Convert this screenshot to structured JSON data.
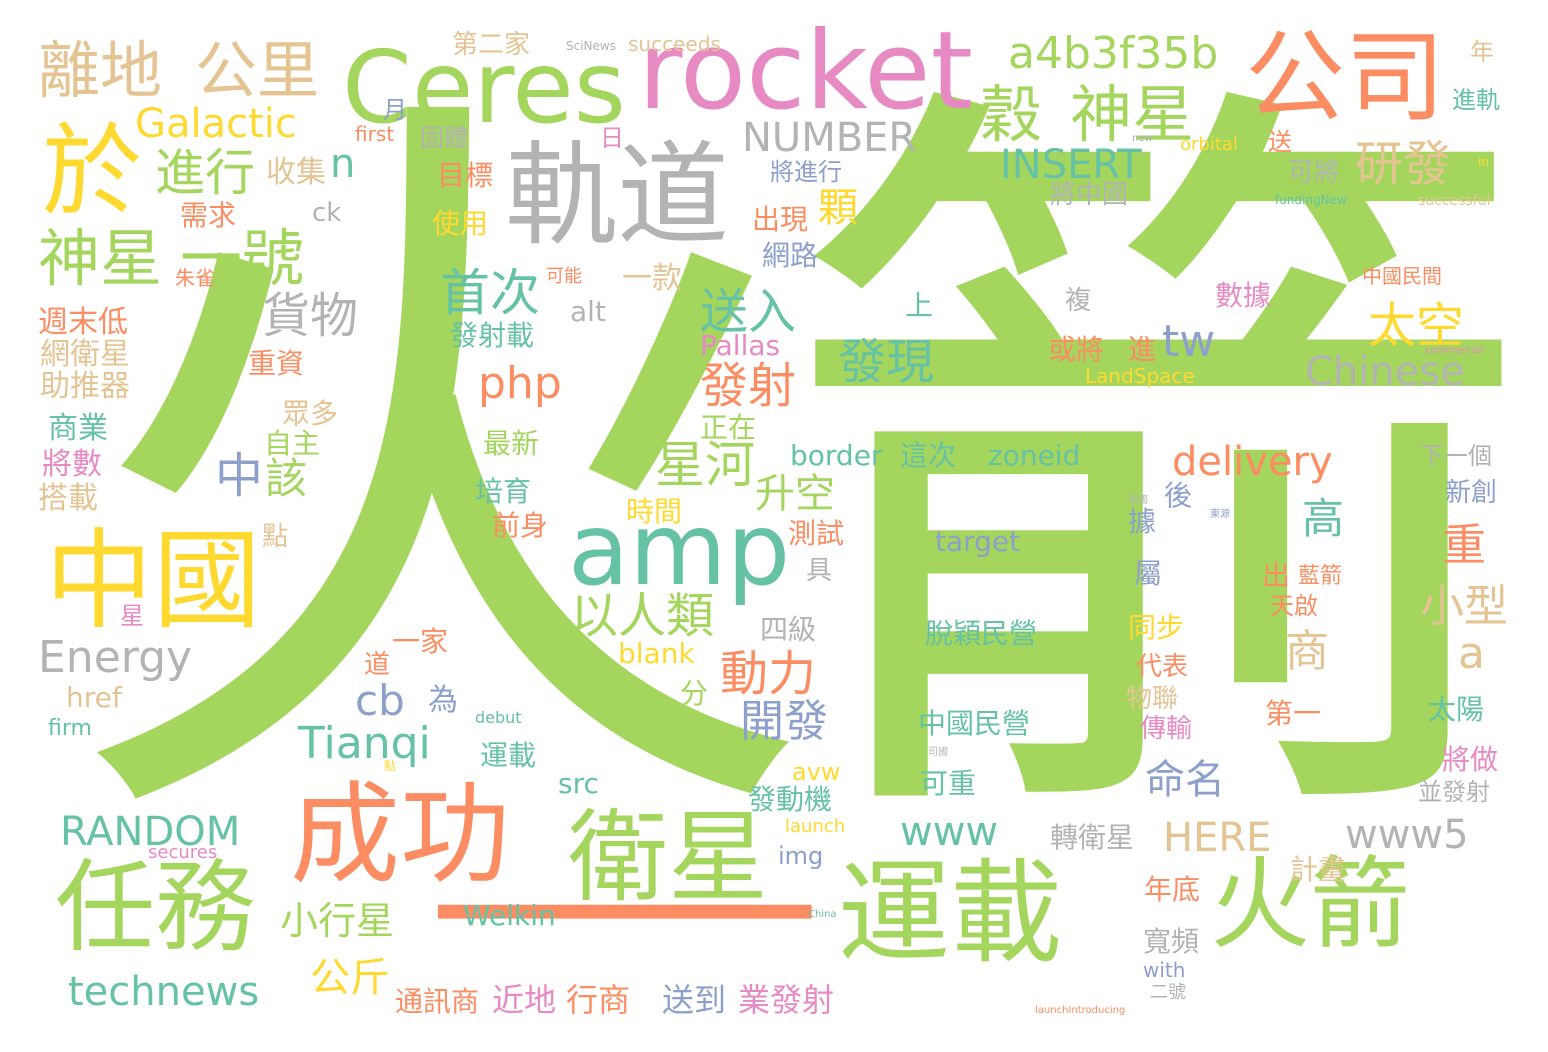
{
  "palette": {
    "green": "#a4d65e",
    "orange": "#fc8d62",
    "teal": "#66c2a5",
    "yellow": "#ffd92f",
    "gray": "#b3b3b3",
    "pink": "#e78ac3",
    "blue": "#8da0cb",
    "tan": "#e5c494"
  },
  "words": [
    "火箭",
    "軌道",
    "rocket",
    "Ceres",
    "公司",
    "成功",
    "運載",
    "火箭",
    "任務",
    "衛星",
    "於",
    "中國",
    "amp",
    "一",
    "神星",
    "一號",
    "離地",
    "公里",
    "a4b3f35b",
    "穀",
    "神星",
    "Galactic",
    "NUMBER",
    "進行",
    "收集",
    "n",
    "INSERT",
    "研發",
    "顆",
    "可將",
    "將中國",
    "首次",
    "送入",
    "發現",
    "貨物",
    "php",
    "發射",
    "tw",
    "太空",
    "Chinese",
    "星河",
    "升空",
    "delivery",
    "中",
    "該",
    "以人類",
    "Energy",
    "動力",
    "小型",
    "商",
    "a",
    "cb",
    "為",
    "Tianqi",
    "開發",
    "命名",
    "RANDOM",
    "www",
    "HERE",
    "www5",
    "technews",
    "公斤",
    "小行星",
    "Welkin",
    "通訊商",
    "近地",
    "行商",
    "送到",
    "業發射",
    "轉衛星",
    "目標",
    "使用",
    "需求",
    "出現",
    "網路",
    "一款",
    "可能",
    "朱雀",
    "ck",
    "alt",
    "發射載",
    "Pallas",
    "週末低",
    "網衛星",
    "助推器",
    "重資",
    "商業",
    "將數",
    "搭載",
    "自主",
    "眾多",
    "最新",
    "培育",
    "前身",
    "時間",
    "border",
    "這次",
    "zoneid",
    "測試",
    "target",
    "四級",
    "脫穎民營",
    "中國民營",
    "可重",
    "發動機",
    "avw",
    "src",
    "運載",
    "blank",
    "href",
    "firm",
    "debut",
    "分",
    "正在",
    "上",
    "或將",
    "進",
    "LandSpace",
    "數據",
    "中國民間",
    "下一個",
    "新創",
    "並發射",
    "太陽",
    "將做",
    "計畫",
    "年底",
    "寬頻",
    "with",
    "二號",
    "第一",
    "傳輸",
    "代表",
    "物聯",
    "同步",
    "出",
    "藍箭",
    "天啟",
    "屬",
    "後",
    "據",
    "重",
    "高",
    "第二家",
    "SciNews",
    "succeeds",
    "月",
    "first",
    "固體",
    "日",
    "將進行",
    "orbital",
    "送",
    "進軌",
    "年",
    "fundingNew",
    "successful",
    "new",
    "in",
    "commercial",
    "launch",
    "secures",
    "img",
    "一家",
    "道",
    "星",
    "點",
    "點",
    "China",
    "launchIntroducing",
    "具",
    "複",
    "帝國",
    "東源",
    "司國"
  ]
}
